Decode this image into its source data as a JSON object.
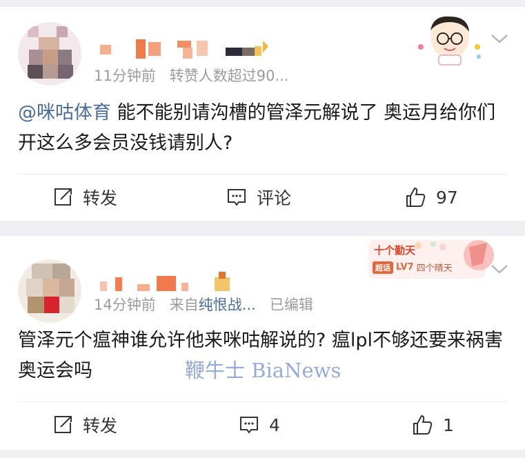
{
  "comments": [
    {
      "meta_time": "11分钟前",
      "meta_extra": "转赞人数超过90...",
      "mention": "@咪咕体育",
      "text": " 能不能别请沟槽的管泽元解说了 奥运月给你们开这么多会员没钱请别人?",
      "actions": {
        "repost": "转发",
        "comment": "评论",
        "like": "97"
      }
    },
    {
      "meta_time": "14分钟前",
      "meta_from": "来自",
      "meta_source": "纯恨战...",
      "meta_edited": "已编辑",
      "text": "管泽元个瘟神谁允许他来咪咕解说的? 瘟lpl不够还要来祸害奥运会吗",
      "actions": {
        "repost": "转发",
        "comment": "4",
        "like": "1"
      },
      "badge": {
        "title": "十个勤天",
        "tag": "超话",
        "level": "LV7",
        "sub": "四个晴天"
      }
    }
  ],
  "watermark": "鞭牛士 BiaNews",
  "colors": {
    "link": "#4a6d98",
    "meta": "#9b9b9b",
    "badge_orange": "#e2683c"
  },
  "icons": [
    "repost-icon",
    "comment-icon",
    "like-icon",
    "chevron-down-icon"
  ]
}
